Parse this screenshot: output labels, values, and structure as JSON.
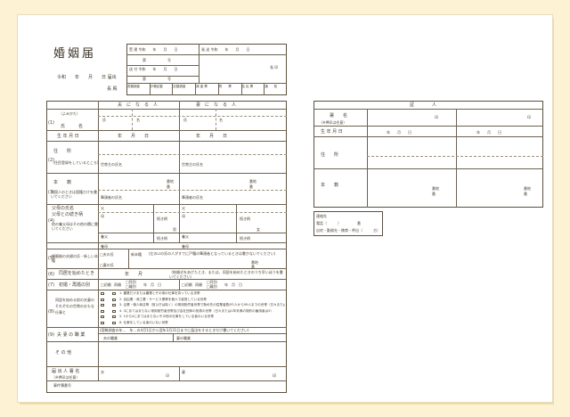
{
  "form": {
    "title": "婚姻届",
    "filing_date": "令和　　年　　月　　日 届出",
    "recipient": "長 殿",
    "receipt": {
      "received": "受 理 令和　　年　　月　　日",
      "number": "第　　　　　　号",
      "sent": "送 付 令和　　年　　月　　日",
      "sent_number": "第　　　　　　号",
      "issued": "発 送 令和　　年　　月　　日",
      "chief": "長 印",
      "review_cells": [
        "書類調査",
        "戸籍記載",
        "記載調査",
        "調 査 票",
        "附　　票",
        "住 民 票",
        "通　　知"
      ]
    },
    "columns": {
      "husband": "夫　に　な　る　人",
      "wife": "妻　に　な　る　人"
    },
    "rows": {
      "r1_num": "(1)",
      "furigana": "（よみかた）",
      "name": "氏　　　名",
      "family_name": "氏",
      "given_name": "名",
      "birth": "生 年 月 日",
      "birth_value": "年　　月　　日",
      "r2_num": "(2)",
      "address": "住　　所",
      "address_note": "（住民登録をしているところ）",
      "householder": "世帯主の氏名",
      "r3_num": "(3)",
      "honseki": "本　　籍",
      "honseki_note": "外国人のときは国籍だけを書いてください",
      "banchi": "番地",
      "ban": "番",
      "head": "筆頭者の氏名",
      "r4_num": "(4)",
      "parents": "父母の氏名",
      "parents2": "父母との続き柄",
      "parents_note": "他の養父母はその他の欄に書いてください",
      "father": "父",
      "mother": "母",
      "relation": "続き柄",
      "eldest": "長",
      "son": "男",
      "daughter": "女",
      "adopt_father": "養父",
      "adopt_mother": "養母",
      "r5_num": "(5)",
      "new_family": "婚姻後の夫婦の氏・新しい本籍",
      "opt_husband": "□夫の氏",
      "opt_wife": "□妻の氏",
      "new_honseki": "新本籍",
      "new_honseki_note": "(左の☑の氏の人がすでに戸籍の筆頭者となっているときは書かないでください)",
      "r6_num": "(6)",
      "cohabit": "同居を始めたとき",
      "cohabit_value": "年　　月",
      "cohabit_note": "（結婚式をあげたとき、または、同居を始めたときのうち早いほうを書いてください）",
      "r7_num": "(7)",
      "marriage_count": "初婚・再婚の別",
      "first": "□初婚",
      "re": "再婚",
      "death": "□死別",
      "divorce": "□離別",
      "ymd": "年　月　日",
      "r8_num": "(8)",
      "occupation_q": "同居を始める前の夫妻のそれぞれの世帯のおもな仕事と",
      "job_husband": "夫",
      "job_wife": "妻",
      "jobs": [
        "1. 農業だけまたは農業とその他の仕事を持っている世帯",
        "2. 自由業・商工業・サービス業等を個人で経営している世帯",
        "3. 企業・個人商店等（官公庁は除く）の常用勤労者世帯で勤め先の従業者数が1人から99人までの世帯（日々または1年未満の契約の雇用者は5）",
        "4. 3にあてはまらない常用勤労者世帯及び会社団体の役員の世帯（日々または1年未満の契約の雇用者は5）",
        "5. 1から4にあてはまらないその他の仕事をしている者のいる世帯",
        "6. 仕事をしている者のいない世帯"
      ],
      "r9_num": "(9)",
      "occupation": "夫 妻 の 職 業",
      "census_note": "(国勢調査の年…　年…の4月1日から翌年3月31日までに届出をするときだけ書いてください)",
      "job_husband_label": "夫の職業",
      "job_wife_label": "妻の職業",
      "other": "そ の 他",
      "signer": "届 出 人 署 名",
      "signer_note": "（※押印は任意）",
      "seal": "印",
      "office": "事件簿番号"
    },
    "witness": {
      "header": "証　　　　人",
      "signature": "署　　名",
      "signature_note": "（※押印は任意）",
      "seal": "印",
      "birth": "生 年 月 日",
      "birth_value": "年　　月　　日",
      "address": "住　　所",
      "honseki": "本　　籍",
      "banchi": "番地",
      "ban": "番"
    },
    "contact": {
      "title": "連絡先",
      "phone": "電話（　　　）　　　　　番",
      "options": "自宅・勤務先・携帯・呼出（　　　方）"
    }
  }
}
